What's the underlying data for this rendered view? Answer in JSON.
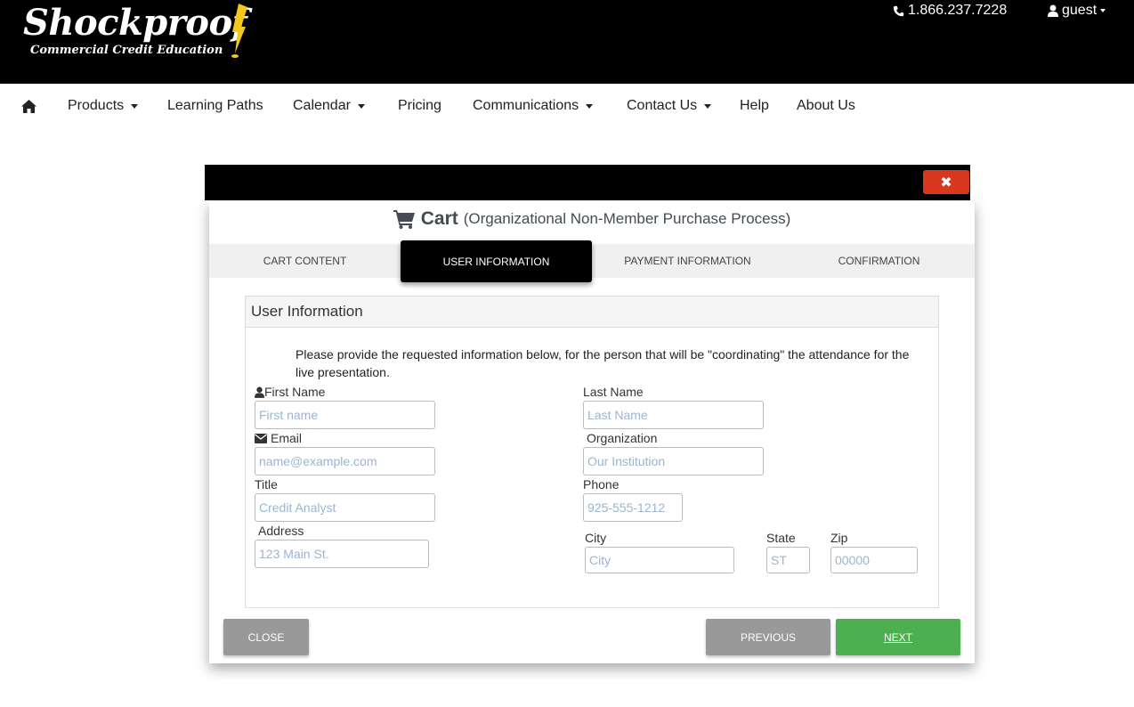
{
  "header": {
    "brand": "Shockproof",
    "tagline": "Commercial Credit Education",
    "phone": "1.866.237.7228",
    "user": "guest"
  },
  "nav": {
    "items": [
      {
        "label": "Products"
      },
      {
        "label": "Learning Paths"
      },
      {
        "label": "Calendar"
      },
      {
        "label": "Pricing"
      },
      {
        "label": "Communications"
      },
      {
        "label": "Contact Us"
      },
      {
        "label": "Help"
      },
      {
        "label": "About Us"
      }
    ]
  },
  "modal": {
    "close_symbol": "✖",
    "title": "Cart",
    "subtitle": "(Organizational Non-Member Purchase Process)",
    "steps": [
      {
        "label": "CART CONTENT"
      },
      {
        "label": "USER INFORMATION"
      },
      {
        "label": "PAYMENT INFORMATION"
      },
      {
        "label": "CONFIRMATION"
      }
    ],
    "active_step": 1,
    "panel": {
      "heading": "User Information",
      "intro": "Please provide the requested information below, for the person that will be \"coordinating\" the attendance for the live presentation."
    },
    "fields": {
      "first_name": {
        "label": "First Name",
        "placeholder": "First name",
        "value": ""
      },
      "last_name": {
        "label": "Last Name",
        "placeholder": "Last Name",
        "value": ""
      },
      "email": {
        "label": "Email",
        "placeholder": "name@example.com",
        "value": ""
      },
      "organization": {
        "label": "Organization",
        "placeholder": "Our Institution",
        "value": ""
      },
      "title": {
        "label": "Title",
        "placeholder": "Credit Analyst",
        "value": ""
      },
      "phone": {
        "label": "Phone",
        "placeholder": "925-555-1212",
        "value": ""
      },
      "address": {
        "label": "Address",
        "placeholder": "123 Main St.",
        "value": ""
      },
      "city": {
        "label": "City",
        "placeholder": "City",
        "value": ""
      },
      "state": {
        "label": "State",
        "placeholder": "ST",
        "value": ""
      },
      "zip": {
        "label": "Zip",
        "placeholder": "00000",
        "value": ""
      }
    },
    "buttons": {
      "close": "CLOSE",
      "previous": "PREVIOUS",
      "next": "NEXT"
    }
  },
  "colors": {
    "topbar": "#000000",
    "close_x": "#d9381e",
    "next": "#4cb050",
    "secondary_button": "#999999",
    "placeholder": "#9bb4d1"
  }
}
